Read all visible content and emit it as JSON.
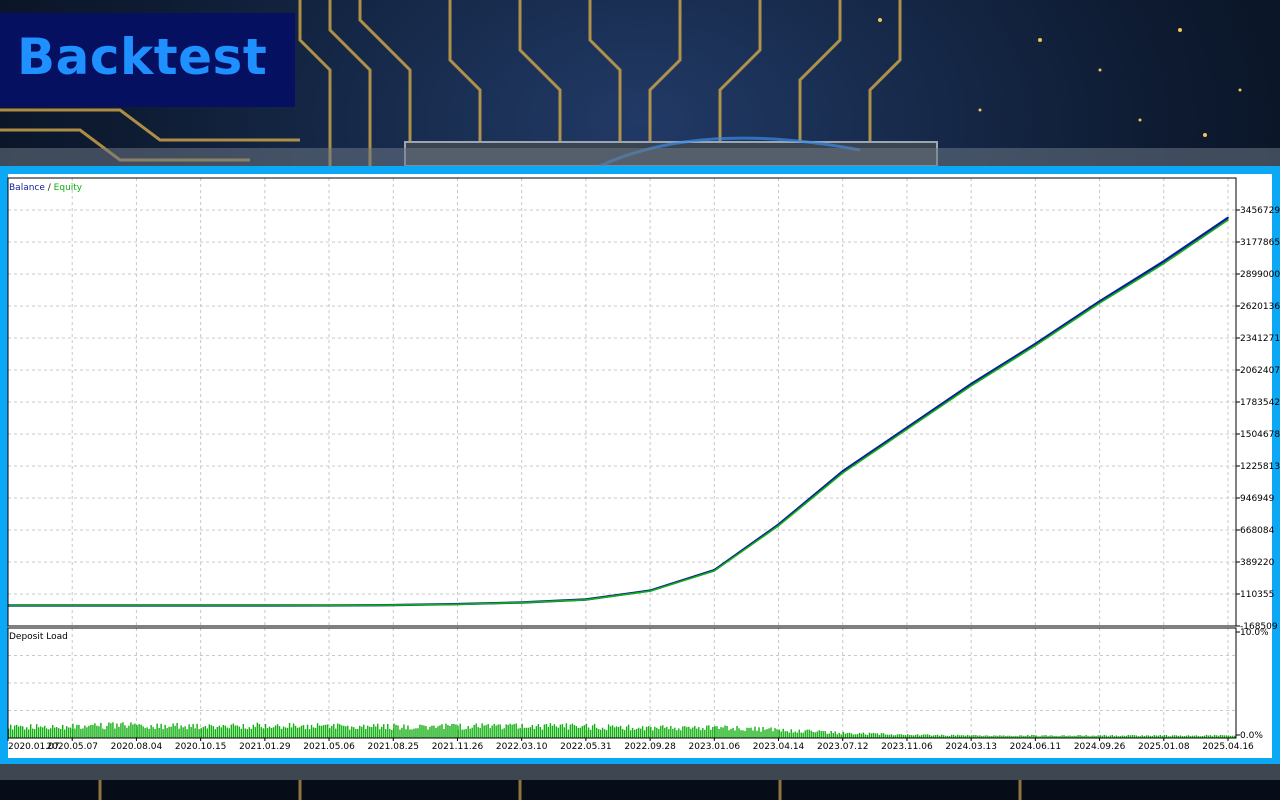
{
  "header": {
    "title": "Backtest"
  },
  "colors": {
    "title_bg": "#061061",
    "title_text": "#1e90ff",
    "frame": "#0aa8f5",
    "balance": "#0b1f9c",
    "equity": "#10b010",
    "deposit_load": "#10b010"
  },
  "legend": {
    "balance": "Balance",
    "separator": " / ",
    "equity": "Equity"
  },
  "deposit_panel": {
    "label": "Deposit Load",
    "ytick_top": "10.0%",
    "ytick_bottom": "0.0%"
  },
  "chart_data": [
    {
      "type": "line",
      "grid": true,
      "legend": [
        "Balance",
        "Equity"
      ],
      "x": [
        "2020.01.07",
        "2020.05.07",
        "2020.08.04",
        "2020.10.15",
        "2021.01.29",
        "2021.05.06",
        "2021.08.25",
        "2021.11.26",
        "2022.03.10",
        "2022.05.31",
        "2022.09.28",
        "2023.01.06",
        "2023.04.14",
        "2023.07.12",
        "2023.11.06",
        "2024.03.13",
        "2024.06.11",
        "2024.09.26",
        "2025.01.08",
        "2025.04.16"
      ],
      "xticks": [
        "2020.01.07",
        "2020.05.07",
        "2020.08.04",
        "2020.10.15",
        "2021.01.29",
        "2021.05.06",
        "2021.08.25",
        "2021.11.26",
        "2022.03.10",
        "2022.05.31",
        "2022.09.28",
        "2023.01.06",
        "2023.04.14",
        "2023.07.12",
        "2023.11.06",
        "2024.03.13",
        "2024.06.11",
        "2024.09.26",
        "2025.01.08",
        "2025.04.16"
      ],
      "yticks": [
        "3456729",
        "3177865",
        "2899000",
        "2620136",
        "2341271",
        "2062407",
        "1783542",
        "1504678",
        "1225813",
        "946949",
        "668084",
        "389220",
        "110355",
        "-168509"
      ],
      "ylim": [
        -168509,
        3456729
      ],
      "series": [
        {
          "name": "Balance",
          "values": [
            10000,
            10000,
            10000,
            10000,
            10000,
            11000,
            14000,
            22000,
            36000,
            62000,
            140000,
            318000,
            715000,
            1180000,
            1560000,
            1940000,
            2290000,
            2660000,
            3010000,
            3390000
          ]
        },
        {
          "name": "Equity",
          "values": [
            10000,
            10000,
            10000,
            10000,
            10000,
            11000,
            14000,
            21000,
            35000,
            60000,
            136000,
            312000,
            705000,
            1165000,
            1545000,
            1925000,
            2275000,
            2645000,
            2990000,
            3370000
          ]
        }
      ]
    },
    {
      "type": "bar",
      "title": "Deposit Load",
      "ylim": [
        0,
        10
      ],
      "x": [
        "2020.01.07",
        "2020.05.07",
        "2020.08.04",
        "2020.10.15",
        "2021.01.29",
        "2021.05.06",
        "2021.08.25",
        "2021.11.26",
        "2022.03.10",
        "2022.05.31",
        "2022.09.28",
        "2023.01.06",
        "2023.04.14",
        "2023.07.12",
        "2023.11.06",
        "2024.03.13",
        "2024.06.11",
        "2024.09.26",
        "2025.01.08",
        "2025.04.16"
      ],
      "values": [
        1.3,
        1.4,
        1.6,
        1.4,
        1.5,
        1.4,
        1.4,
        1.4,
        1.5,
        1.4,
        1.3,
        1.3,
        1.0,
        0.6,
        0.4,
        0.3,
        0.3,
        0.3,
        0.3,
        0.3
      ]
    }
  ]
}
